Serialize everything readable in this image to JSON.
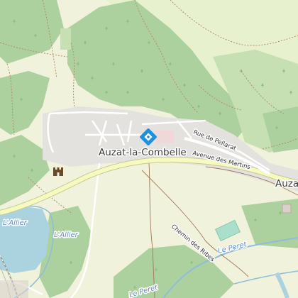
{
  "map": {
    "place_labels": {
      "town": "Auzat-la-Combelle",
      "town_cut": "Auza"
    },
    "street_labels": {
      "rue_pellarat": "Rue de Pellarat",
      "avenue_martins": "Avenue des Martins",
      "chemin_ribes": "Chemin des Ribes"
    },
    "water_labels": {
      "allier_1": "L'Allier",
      "allier_2": "L'Allier",
      "le_peret_1": "Le Peret",
      "le_peret_2": "Le Peret"
    },
    "pois": {
      "info_marker": "info-diamond-icon",
      "castle": "castle-icon"
    },
    "colors": {
      "forest": "#add19e",
      "meadow": "#cdebb0",
      "farmland": "#eef0d5",
      "residential": "#e0dfdf",
      "water": "#aad3df",
      "road_major": "#f7fabf",
      "road_outline": "#c7c993",
      "river_line": "#8fbcd8",
      "path": "#a0785a",
      "marker": "#1e90e0"
    }
  }
}
